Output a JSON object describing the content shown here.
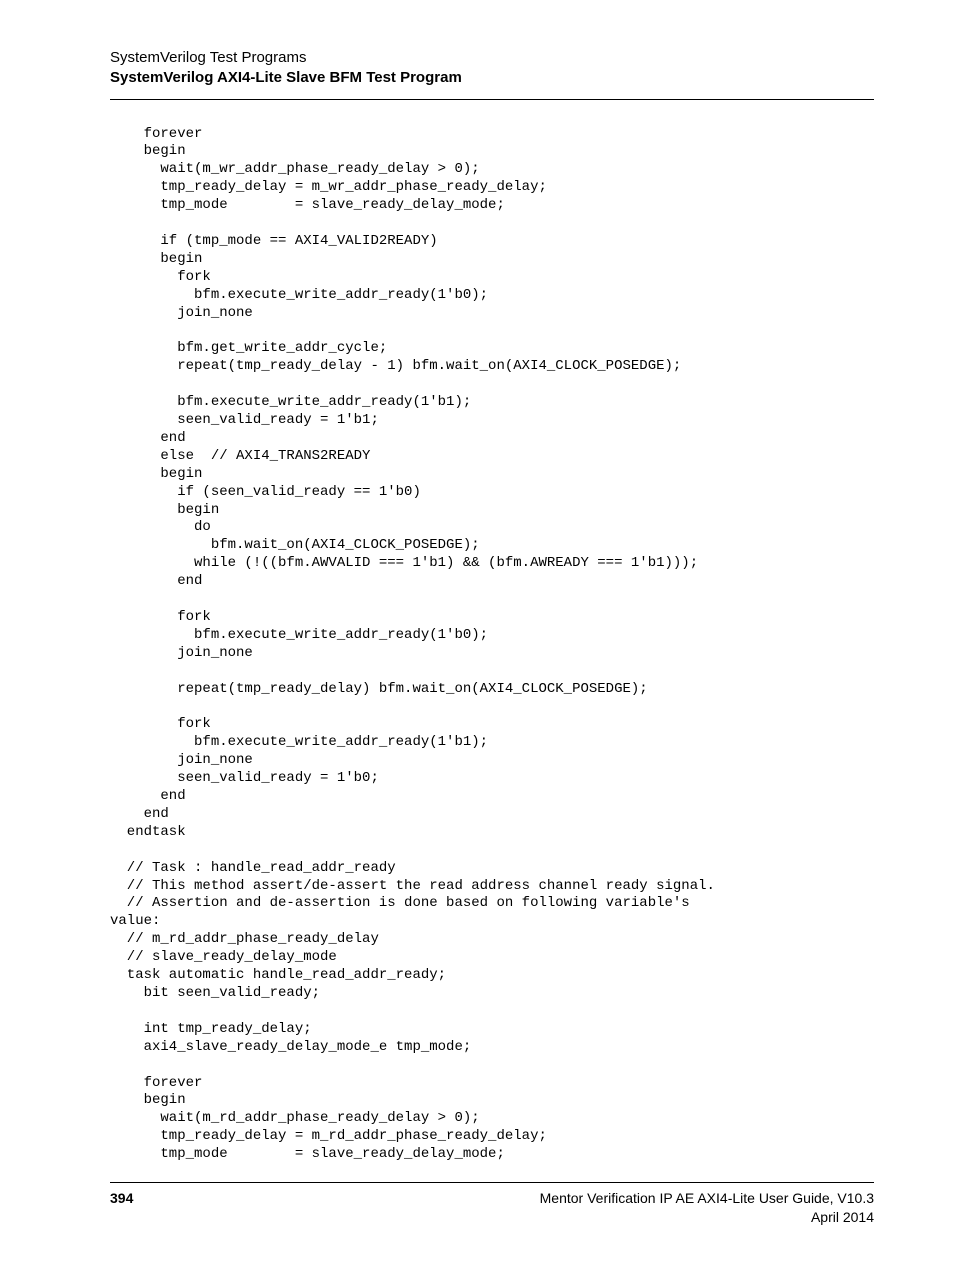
{
  "header": {
    "line1": "SystemVerilog Test Programs",
    "line2": "SystemVerilog AXI4-Lite Slave BFM Test Program"
  },
  "code": "    forever\n    begin\n      wait(m_wr_addr_phase_ready_delay > 0);\n      tmp_ready_delay = m_wr_addr_phase_ready_delay;\n      tmp_mode        = slave_ready_delay_mode;\n\n      if (tmp_mode == AXI4_VALID2READY)\n      begin\n        fork\n          bfm.execute_write_addr_ready(1'b0);\n        join_none\n\n        bfm.get_write_addr_cycle;\n        repeat(tmp_ready_delay - 1) bfm.wait_on(AXI4_CLOCK_POSEDGE);\n\n        bfm.execute_write_addr_ready(1'b1);\n        seen_valid_ready = 1'b1;\n      end\n      else  // AXI4_TRANS2READY\n      begin\n        if (seen_valid_ready == 1'b0)\n        begin\n          do\n            bfm.wait_on(AXI4_CLOCK_POSEDGE);\n          while (!((bfm.AWVALID === 1'b1) && (bfm.AWREADY === 1'b1)));\n        end\n\n        fork\n          bfm.execute_write_addr_ready(1'b0);\n        join_none\n\n        repeat(tmp_ready_delay) bfm.wait_on(AXI4_CLOCK_POSEDGE);\n\n        fork\n          bfm.execute_write_addr_ready(1'b1);\n        join_none\n        seen_valid_ready = 1'b0;\n      end\n    end\n  endtask\n\n  // Task : handle_read_addr_ready\n  // This method assert/de-assert the read address channel ready signal.\n  // Assertion and de-assertion is done based on following variable's\nvalue:\n  // m_rd_addr_phase_ready_delay\n  // slave_ready_delay_mode\n  task automatic handle_read_addr_ready;\n    bit seen_valid_ready;\n\n    int tmp_ready_delay;\n    axi4_slave_ready_delay_mode_e tmp_mode;\n\n    forever\n    begin\n      wait(m_rd_addr_phase_ready_delay > 0);\n      tmp_ready_delay = m_rd_addr_phase_ready_delay;\n      tmp_mode        = slave_ready_delay_mode;",
  "footer": {
    "page": "394",
    "title": "Mentor Verification IP AE AXI4-Lite User Guide, V10.3",
    "date": "April 2014"
  }
}
